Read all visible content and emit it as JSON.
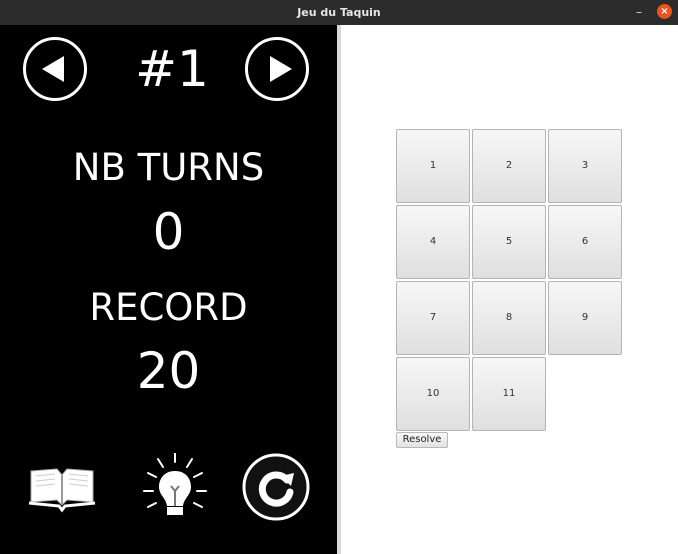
{
  "window": {
    "title": "Jeu du Taquin",
    "minimize_label": "–",
    "close_label": "×"
  },
  "sidebar": {
    "level": "#1",
    "turns_label": "NB TURNS",
    "turns_value": "0",
    "record_label": "RECORD",
    "record_value": "20",
    "icons": [
      "left-arrow-icon",
      "right-arrow-icon",
      "book-icon",
      "lightbulb-icon",
      "restart-icon"
    ]
  },
  "board": {
    "tiles": [
      "1",
      "2",
      "3",
      "4",
      "5",
      "6",
      "7",
      "8",
      "9",
      "10",
      "11"
    ],
    "resolve_label": "Resolve"
  }
}
